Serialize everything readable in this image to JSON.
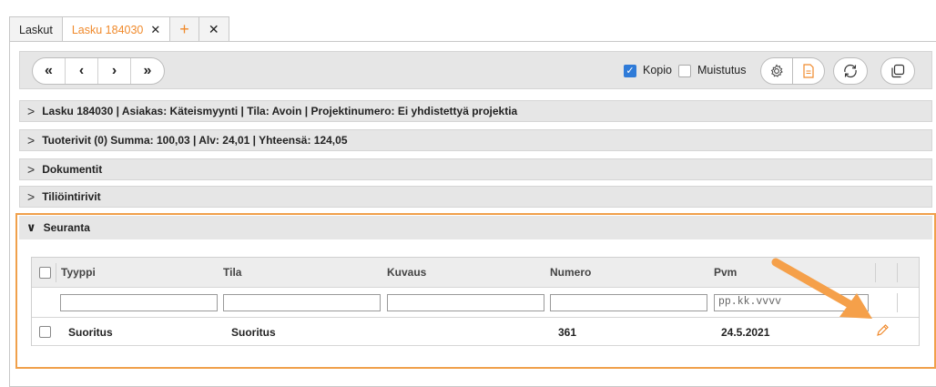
{
  "tabs": [
    {
      "label": "Laskut"
    },
    {
      "label": "Lasku 184030",
      "close": "✕"
    },
    {
      "label": "+"
    },
    {
      "label": "✕"
    }
  ],
  "toolbar": {
    "nav": [
      "«",
      "‹",
      "›",
      "»"
    ],
    "kopio_label": "Kopio",
    "kopio_checked": true,
    "muistutus_label": "Muistutus",
    "muistutus_checked": false,
    "icons": [
      "gear-icon",
      "document-icon",
      "refresh-icon",
      "copy-icon"
    ]
  },
  "sections": [
    {
      "label": "Lasku 184030 | Asiakas: Käteismyynti | Tila: Avoin | Projektinumero: Ei yhdistettyä projektia",
      "expanded": false
    },
    {
      "label": "Tuoterivit (0) Summa: 100,03 | Alv: 24,01 | Yhteensä: 124,05",
      "expanded": false
    },
    {
      "label": "Dokumentit",
      "expanded": false
    },
    {
      "label": "Tiliöintirivit",
      "expanded": false
    },
    {
      "label": "Seuranta",
      "expanded": true
    }
  ],
  "grid": {
    "columns": [
      "Tyyppi",
      "Tila",
      "Kuvaus",
      "Numero",
      "Pvm"
    ],
    "date_placeholder": "pp.kk.vvvv",
    "rows": [
      {
        "tyyppi": "Suoritus",
        "tila": "Suoritus",
        "kuvaus": "",
        "numero": "361",
        "pvm": "24.5.2021"
      }
    ]
  },
  "colors": {
    "accent": "#f08a2c",
    "highlight": "#f0a04b",
    "checkbox": "#2f7bd8"
  }
}
